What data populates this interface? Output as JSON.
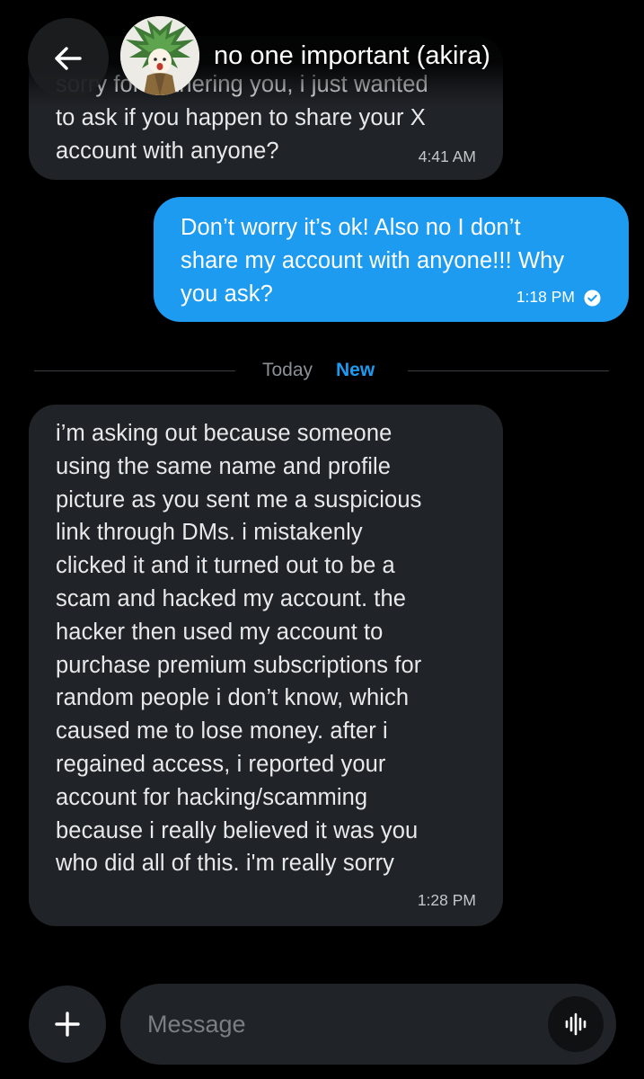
{
  "header": {
    "contact_name": "no one important (akira)"
  },
  "messages": [
    {
      "direction": "incoming",
      "lines": [
        "sorry for bothering you, i just wanted",
        "to ask if you happen to share your X",
        "account with anyone?"
      ],
      "time": "4:41 AM"
    },
    {
      "direction": "outgoing",
      "lines": [
        "Don’t worry it’s ok! Also no I don’t",
        "share my account with anyone!!! Why",
        "you ask?"
      ],
      "time": "1:18 PM",
      "status": "read"
    },
    {
      "direction": "incoming",
      "lines": [
        "i’m asking out because someone",
        "using the same name and profile",
        "picture as you sent me a suspicious",
        "link through DMs. i mistakenly",
        "clicked it and it turned out to be a",
        "scam and hacked my account. the",
        "hacker then used my account to",
        "purchase premium subscriptions for",
        "random people i don’t know, which",
        "caused me to lose money. after i",
        "regained access, i reported your",
        "account for hacking/scamming",
        "because i really believed it was you",
        "who did all of this. i'm really sorry"
      ],
      "time": "1:28 PM"
    }
  ],
  "divider": {
    "day_label": "Today",
    "new_label": "New"
  },
  "composer": {
    "placeholder": "Message",
    "value": ""
  },
  "icons": {
    "back": "arrow-left-icon",
    "plus": "plus-icon",
    "voice": "waveform-icon",
    "read": "check-circle-icon"
  },
  "colors": {
    "background": "#000000",
    "incoming_bubble": "#202327",
    "outgoing_bubble": "#1d9bf0",
    "accent": "#1d9bf0"
  }
}
